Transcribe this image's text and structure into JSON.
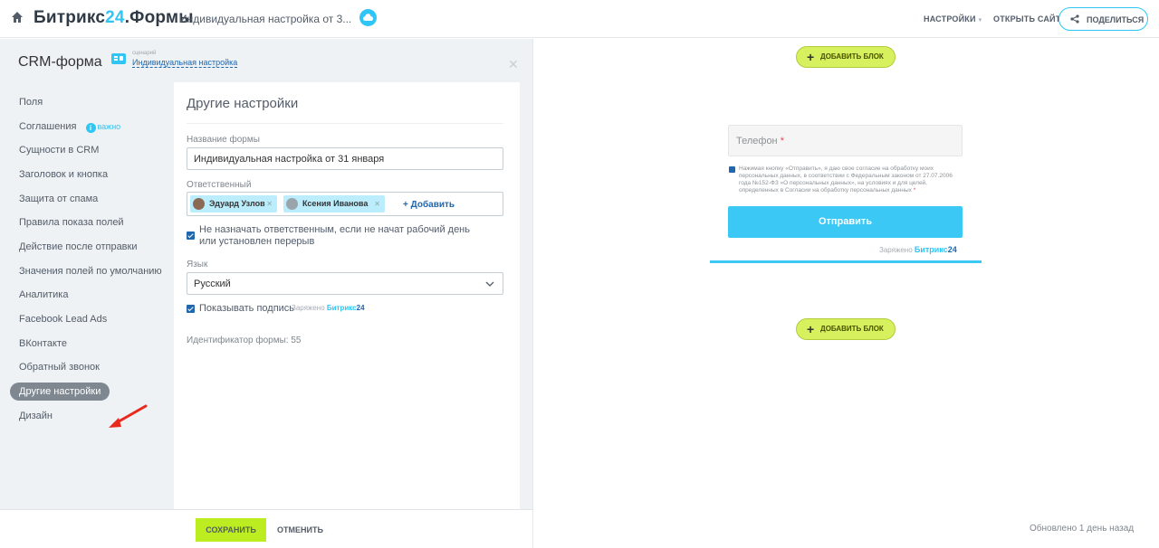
{
  "topbar": {
    "brand_prefix": "Битрикс",
    "brand_num": "24",
    "brand_suffix": ".Формы",
    "doc_title": "Индивидуальная настройка от 3...",
    "settings": "НАСТРОЙКИ",
    "open_site": "ОТКРЫТЬ САЙТ",
    "share": "ПОДЕЛИТЬСЯ"
  },
  "panel": {
    "title": "CRM-форма",
    "scenario_caption": "сценарий",
    "scenario_name": "Индивидуальная настройка"
  },
  "nav": {
    "items": [
      {
        "label": "Поля"
      },
      {
        "label": "Соглашения",
        "badge": "важно"
      },
      {
        "label": "Сущности в CRM"
      },
      {
        "label": "Заголовок и кнопка"
      },
      {
        "label": "Защита от спама"
      },
      {
        "label": "Правила показа полей"
      },
      {
        "label": "Действие после отправки"
      },
      {
        "label": "Значения полей по умолчанию"
      },
      {
        "label": "Аналитика"
      },
      {
        "label": "Facebook Lead Ads"
      },
      {
        "label": "ВКонтакте"
      },
      {
        "label": "Обратный звонок"
      },
      {
        "label": "Другие настройки",
        "active": true
      },
      {
        "label": "Дизайн"
      }
    ]
  },
  "settings_card": {
    "title": "Другие настройки",
    "form_name_label": "Название формы",
    "form_name_value": "Индивидуальная настройка от 31 января",
    "responsible_label": "Ответственный",
    "responsible": [
      "Эдуард Узлов",
      "Ксения Иванова"
    ],
    "add_label": "+ Добавить",
    "no_assign_label": "Не назначать ответственным, если не начат рабочий день или установлен перерыв",
    "language_label": "Язык",
    "language_value": "Русский",
    "show_signature_label": "Показывать подпись",
    "powered_prefix": "Заряжено",
    "powered_brand": "Битрикс",
    "powered_num": "24",
    "form_id_label": "Идентификатор формы: 55"
  },
  "footer": {
    "save": "СОХРАНИТЬ",
    "cancel": "ОТМЕНИТЬ"
  },
  "preview": {
    "add_block": "ДОБАВИТЬ БЛОК",
    "phone_placeholder": "Телефон",
    "required_mark": "*",
    "consent": "Нажимая кнопку «Отправить», я даю свое согласие на обработку моих персональных данных, в соответствии с Федеральным законом от 27.07.2006 года №152-ФЗ «О персональных данных», на условиях и для целей, определенных в Согласии на обработку персональных данных",
    "submit": "Отправить",
    "powered_prefix": "Заряжено",
    "powered_brand": "Битрикс",
    "powered_num": "24",
    "updated": "Обновлено 1 день назад"
  },
  "colors": {
    "accent": "#2fc6f6",
    "link": "#2067b0",
    "save_green": "#bbed21",
    "add_block_green": "#d6f15d",
    "arrow_red": "#e8291c"
  },
  "icons": {
    "home": "home-icon",
    "cloud": "cloud-icon",
    "share": "share-icon",
    "close": "close-icon",
    "arrow": "arrow-icon"
  }
}
